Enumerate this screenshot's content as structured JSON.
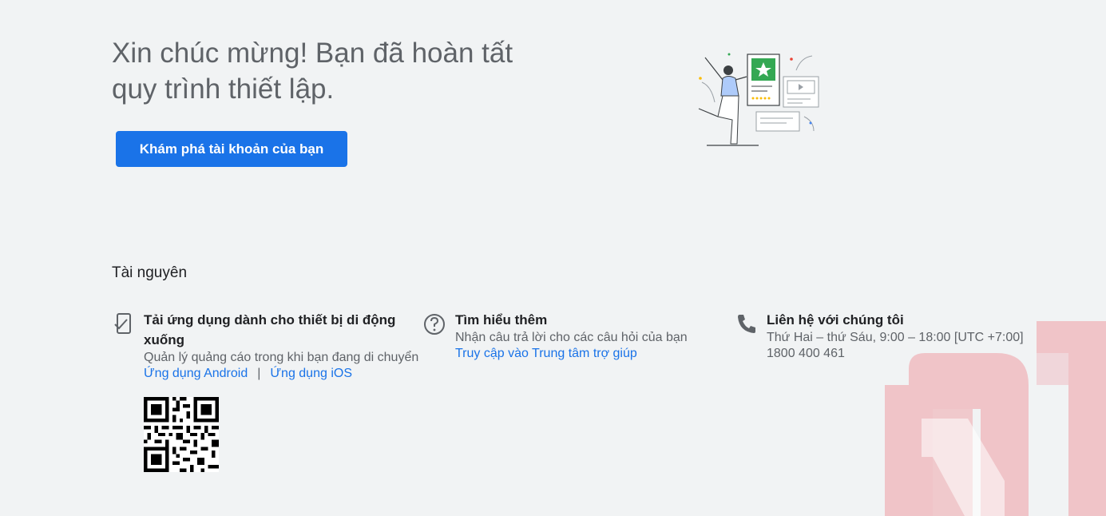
{
  "headline": "Xin chúc mừng! Bạn đã hoàn tất quy trình thiết lập.",
  "cta_label": "Khám phá tài khoản của bạn",
  "resources": {
    "title": "Tài nguyên",
    "mobile": {
      "title": "Tải ứng dụng dành cho thiết bị di động xuống",
      "desc": "Quản lý quảng cáo trong khi bạn đang di chuyển",
      "android_link": "Ứng dụng Android",
      "separator": "|",
      "ios_link": "Ứng dụng iOS"
    },
    "learn": {
      "title": "Tìm hiểu thêm",
      "desc": "Nhận câu trả lời cho các câu hỏi của bạn",
      "link": "Truy cập vào Trung tâm trợ giúp"
    },
    "contact": {
      "title": "Liên hệ với chúng tôi",
      "hours": "Thứ Hai – thứ Sáu, 9:00 – 18:00 [UTC +7:00]",
      "phone": "1800 400 461"
    }
  },
  "icons": {
    "mobile": "phone-check-icon",
    "help": "question-circle-icon",
    "contact": "telephone-icon"
  },
  "colors": {
    "accent": "#1a73e8",
    "background": "#f1f3f4",
    "watermark": "#f0c4c8"
  }
}
